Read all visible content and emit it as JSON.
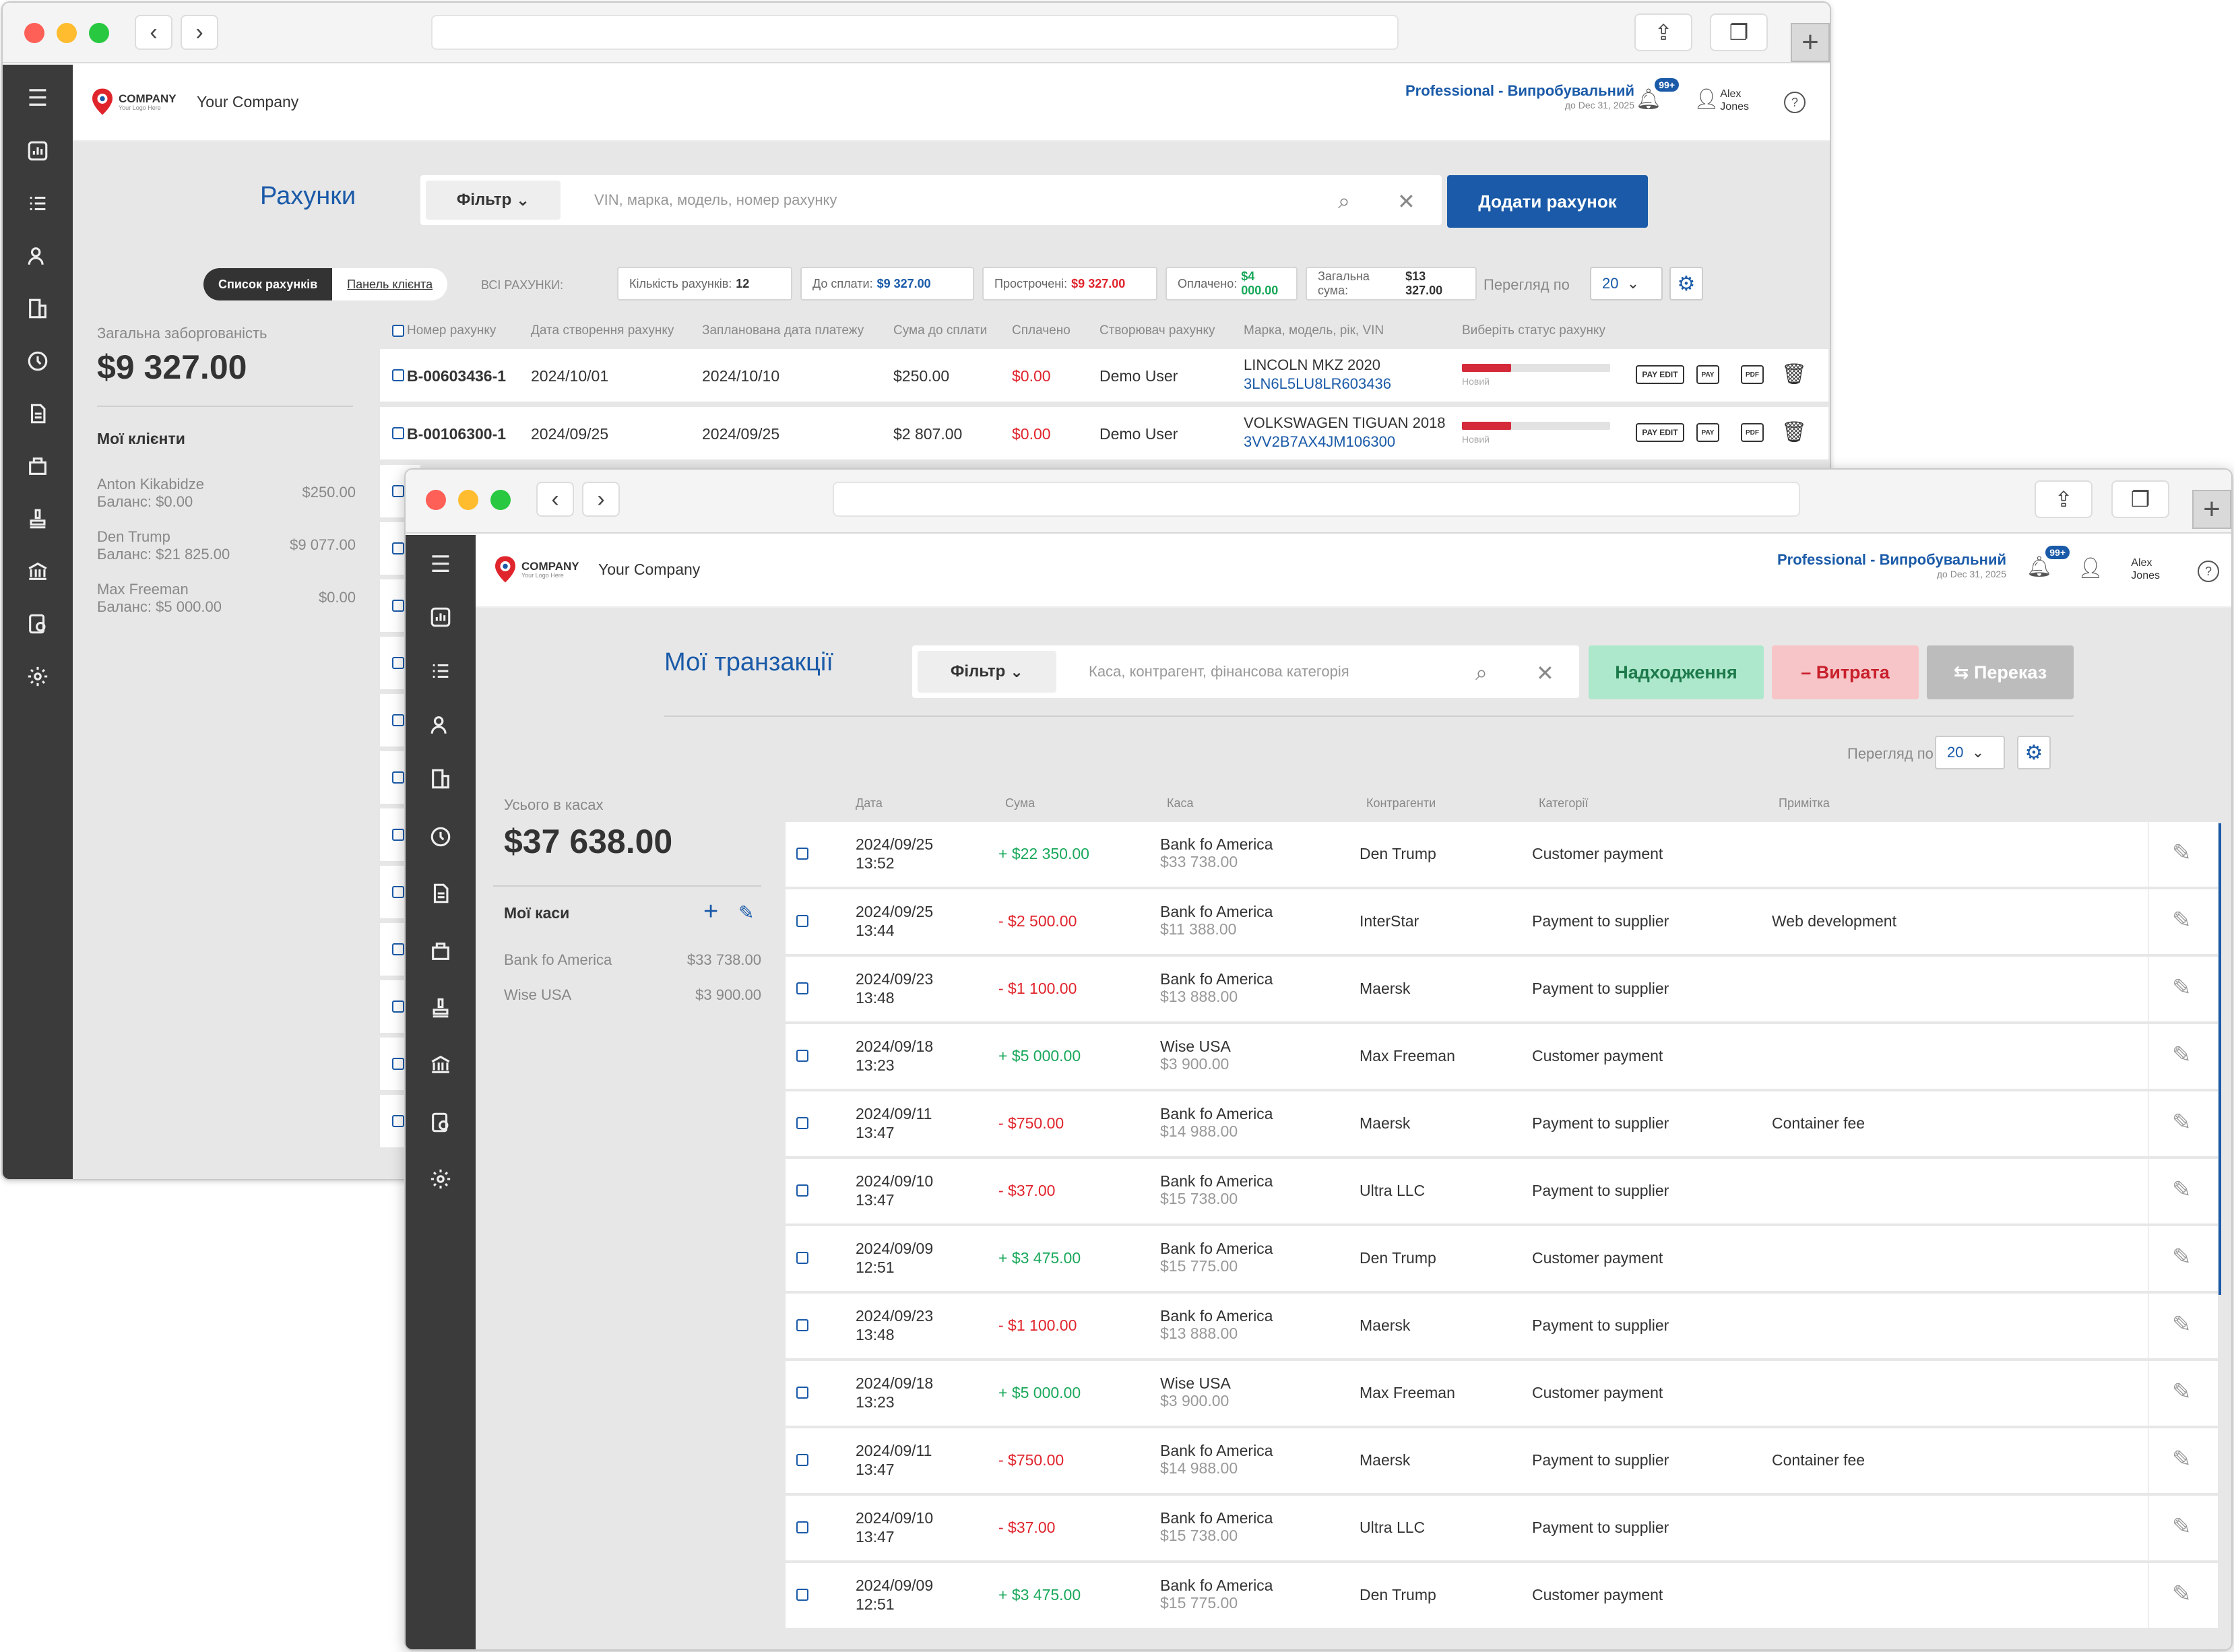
{
  "win1": {
    "company": "Your Company",
    "logo_text": "COMPANY",
    "logo_sub": "Your Logo Here",
    "plan": "Professional - Випробувальний",
    "plan_until": "до Dec 31, 2025",
    "notifications": "99+",
    "user_first": "Alex",
    "user_last": "Jones",
    "title": "Рахунки",
    "filter_label": "Фільтр",
    "search_placeholder": "VIN, марка, модель, номер рахунку",
    "add_button": "Додати рахунок",
    "tab_list": "Список рахунків",
    "tab_client": "Панель клієнта",
    "all_label": "ВСІ РАХУНКИ:",
    "stats": [
      {
        "label": "Кількість рахунків:",
        "value": "12",
        "color": "#333333"
      },
      {
        "label": "До сплати:",
        "value": "$9 327.00",
        "color": "#1a5aa8"
      },
      {
        "label": "Прострочені:",
        "value": "$9 327.00",
        "color": "#e0242c"
      },
      {
        "label": "Оплачено:",
        "value": "$4 000.00",
        "color": "#18a85a"
      },
      {
        "label": "Загальна сума:",
        "value": "$13 327.00",
        "color": "#333333"
      }
    ],
    "view_label": "Перегляд по",
    "view_value": "20",
    "debt_label": "Загальна заборгованість",
    "debt_total": "$9 327.00",
    "clients_heading": "Мої клієнти",
    "clients": [
      {
        "name": "Anton Kikabidze",
        "balance": "Баланс: $0.00",
        "amount": "$250.00"
      },
      {
        "name": "Den Trump",
        "balance": "Баланс: $21 825.00",
        "amount": "$9 077.00"
      },
      {
        "name": "Max Freeman",
        "balance": "Баланс: $5 000.00",
        "amount": "$0.00"
      }
    ],
    "columns": [
      "Номер рахунку",
      "Дата створення рахунку",
      "Запланована дата платежу",
      "Сума до сплати",
      "Сплачено",
      "Створювач рахунку",
      "Марка, модель, рік, VIN",
      "Виберіть статус рахунку"
    ],
    "rows": [
      {
        "number": "B-00603436-1",
        "created": "2024/10/01",
        "due": "2024/10/10",
        "amount": "$250.00",
        "paid": "$0.00",
        "creator": "Demo User",
        "car": "LINCOLN MKZ 2020",
        "vin": "3LN6L5LU8LR603436",
        "status": "Новий",
        "progress": 0.33
      },
      {
        "number": "B-00106300-1",
        "created": "2024/09/25",
        "due": "2024/09/25",
        "amount": "$2 807.00",
        "paid": "$0.00",
        "creator": "Demo User",
        "car": "VOLKSWAGEN TIGUAN 2018",
        "vin": "3VV2B7AX4JM106300",
        "status": "Новий",
        "progress": 0.33
      }
    ],
    "actions": {
      "pay_edit": "PAY EDIT",
      "pay": "PAY",
      "pdf": "PDF"
    }
  },
  "win2": {
    "company": "Your Company",
    "logo_text": "COMPANY",
    "logo_sub": "Your Logo Here",
    "plan": "Professional - Випробувальний",
    "plan_until": "до Dec 31, 2025",
    "notifications": "99+",
    "user_first": "Alex",
    "user_last": "Jones",
    "title": "Мої транзакції",
    "filter_label": "Фільтр",
    "search_placeholder": "Каса, контрагент, фінансова категорія",
    "btn_income": "Надходження",
    "btn_expense": "– Витрата",
    "btn_transfer": "⇆ Переказ",
    "view_label": "Перегляд по",
    "view_value": "20",
    "cash_label": "Усього в касах",
    "cash_total": "$37 638.00",
    "cashboxes_heading": "Мої каси",
    "cashboxes": [
      {
        "name": "Bank fo America",
        "amount": "$33 738.00"
      },
      {
        "name": "Wise USA",
        "amount": "$3 900.00"
      }
    ],
    "columns": [
      "Дата",
      "Сума",
      "Каса",
      "Контрагенти",
      "Категорії",
      "Примітка"
    ],
    "rows": [
      {
        "date": "2024/09/25",
        "time": "13:52",
        "amount": "+ $22 350.00",
        "type": "in",
        "cash": "Bank fo America",
        "cash_bal": "$33 738.00",
        "party": "Den Trump",
        "category": "Customer payment",
        "note": ""
      },
      {
        "date": "2024/09/25",
        "time": "13:44",
        "amount": "- $2 500.00",
        "type": "out",
        "cash": "Bank fo America",
        "cash_bal": "$11 388.00",
        "party": "InterStar",
        "category": "Payment to supplier",
        "note": "Web development"
      },
      {
        "date": "2024/09/23",
        "time": "13:48",
        "amount": "- $1 100.00",
        "type": "out",
        "cash": "Bank fo America",
        "cash_bal": "$13 888.00",
        "party": "Maersk",
        "category": "Payment to supplier",
        "note": ""
      },
      {
        "date": "2024/09/18",
        "time": "13:23",
        "amount": "+ $5 000.00",
        "type": "in",
        "cash": "Wise USA",
        "cash_bal": "$3 900.00",
        "party": "Max Freeman",
        "category": "Customer payment",
        "note": ""
      },
      {
        "date": "2024/09/11",
        "time": "13:47",
        "amount": "- $750.00",
        "type": "out",
        "cash": "Bank fo America",
        "cash_bal": "$14 988.00",
        "party": "Maersk",
        "category": "Payment to supplier",
        "note": "Container fee"
      },
      {
        "date": "2024/09/10",
        "time": "13:47",
        "amount": "- $37.00",
        "type": "out",
        "cash": "Bank fo America",
        "cash_bal": "$15 738.00",
        "party": "Ultra LLC",
        "category": "Payment to supplier",
        "note": ""
      },
      {
        "date": "2024/09/09",
        "time": "12:51",
        "amount": "+ $3 475.00",
        "type": "in",
        "cash": "Bank fo America",
        "cash_bal": "$15 775.00",
        "party": "Den Trump",
        "category": "Customer payment",
        "note": ""
      },
      {
        "date": "2024/09/23",
        "time": "13:48",
        "amount": "- $1 100.00",
        "type": "out",
        "cash": "Bank fo America",
        "cash_bal": "$13 888.00",
        "party": "Maersk",
        "category": "Payment to supplier",
        "note": ""
      },
      {
        "date": "2024/09/18",
        "time": "13:23",
        "amount": "+ $5 000.00",
        "type": "in",
        "cash": "Wise USA",
        "cash_bal": "$3 900.00",
        "party": "Max Freeman",
        "category": "Customer payment",
        "note": ""
      },
      {
        "date": "2024/09/11",
        "time": "13:47",
        "amount": "- $750.00",
        "type": "out",
        "cash": "Bank fo America",
        "cash_bal": "$14 988.00",
        "party": "Maersk",
        "category": "Payment to supplier",
        "note": "Container fee"
      },
      {
        "date": "2024/09/10",
        "time": "13:47",
        "amount": "- $37.00",
        "type": "out",
        "cash": "Bank fo America",
        "cash_bal": "$15 738.00",
        "party": "Ultra LLC",
        "category": "Payment to supplier",
        "note": ""
      },
      {
        "date": "2024/09/09",
        "time": "12:51",
        "amount": "+ $3 475.00",
        "type": "in",
        "cash": "Bank fo America",
        "cash_bal": "$15 775.00",
        "party": "Den Trump",
        "category": "Customer payment",
        "note": ""
      }
    ]
  }
}
